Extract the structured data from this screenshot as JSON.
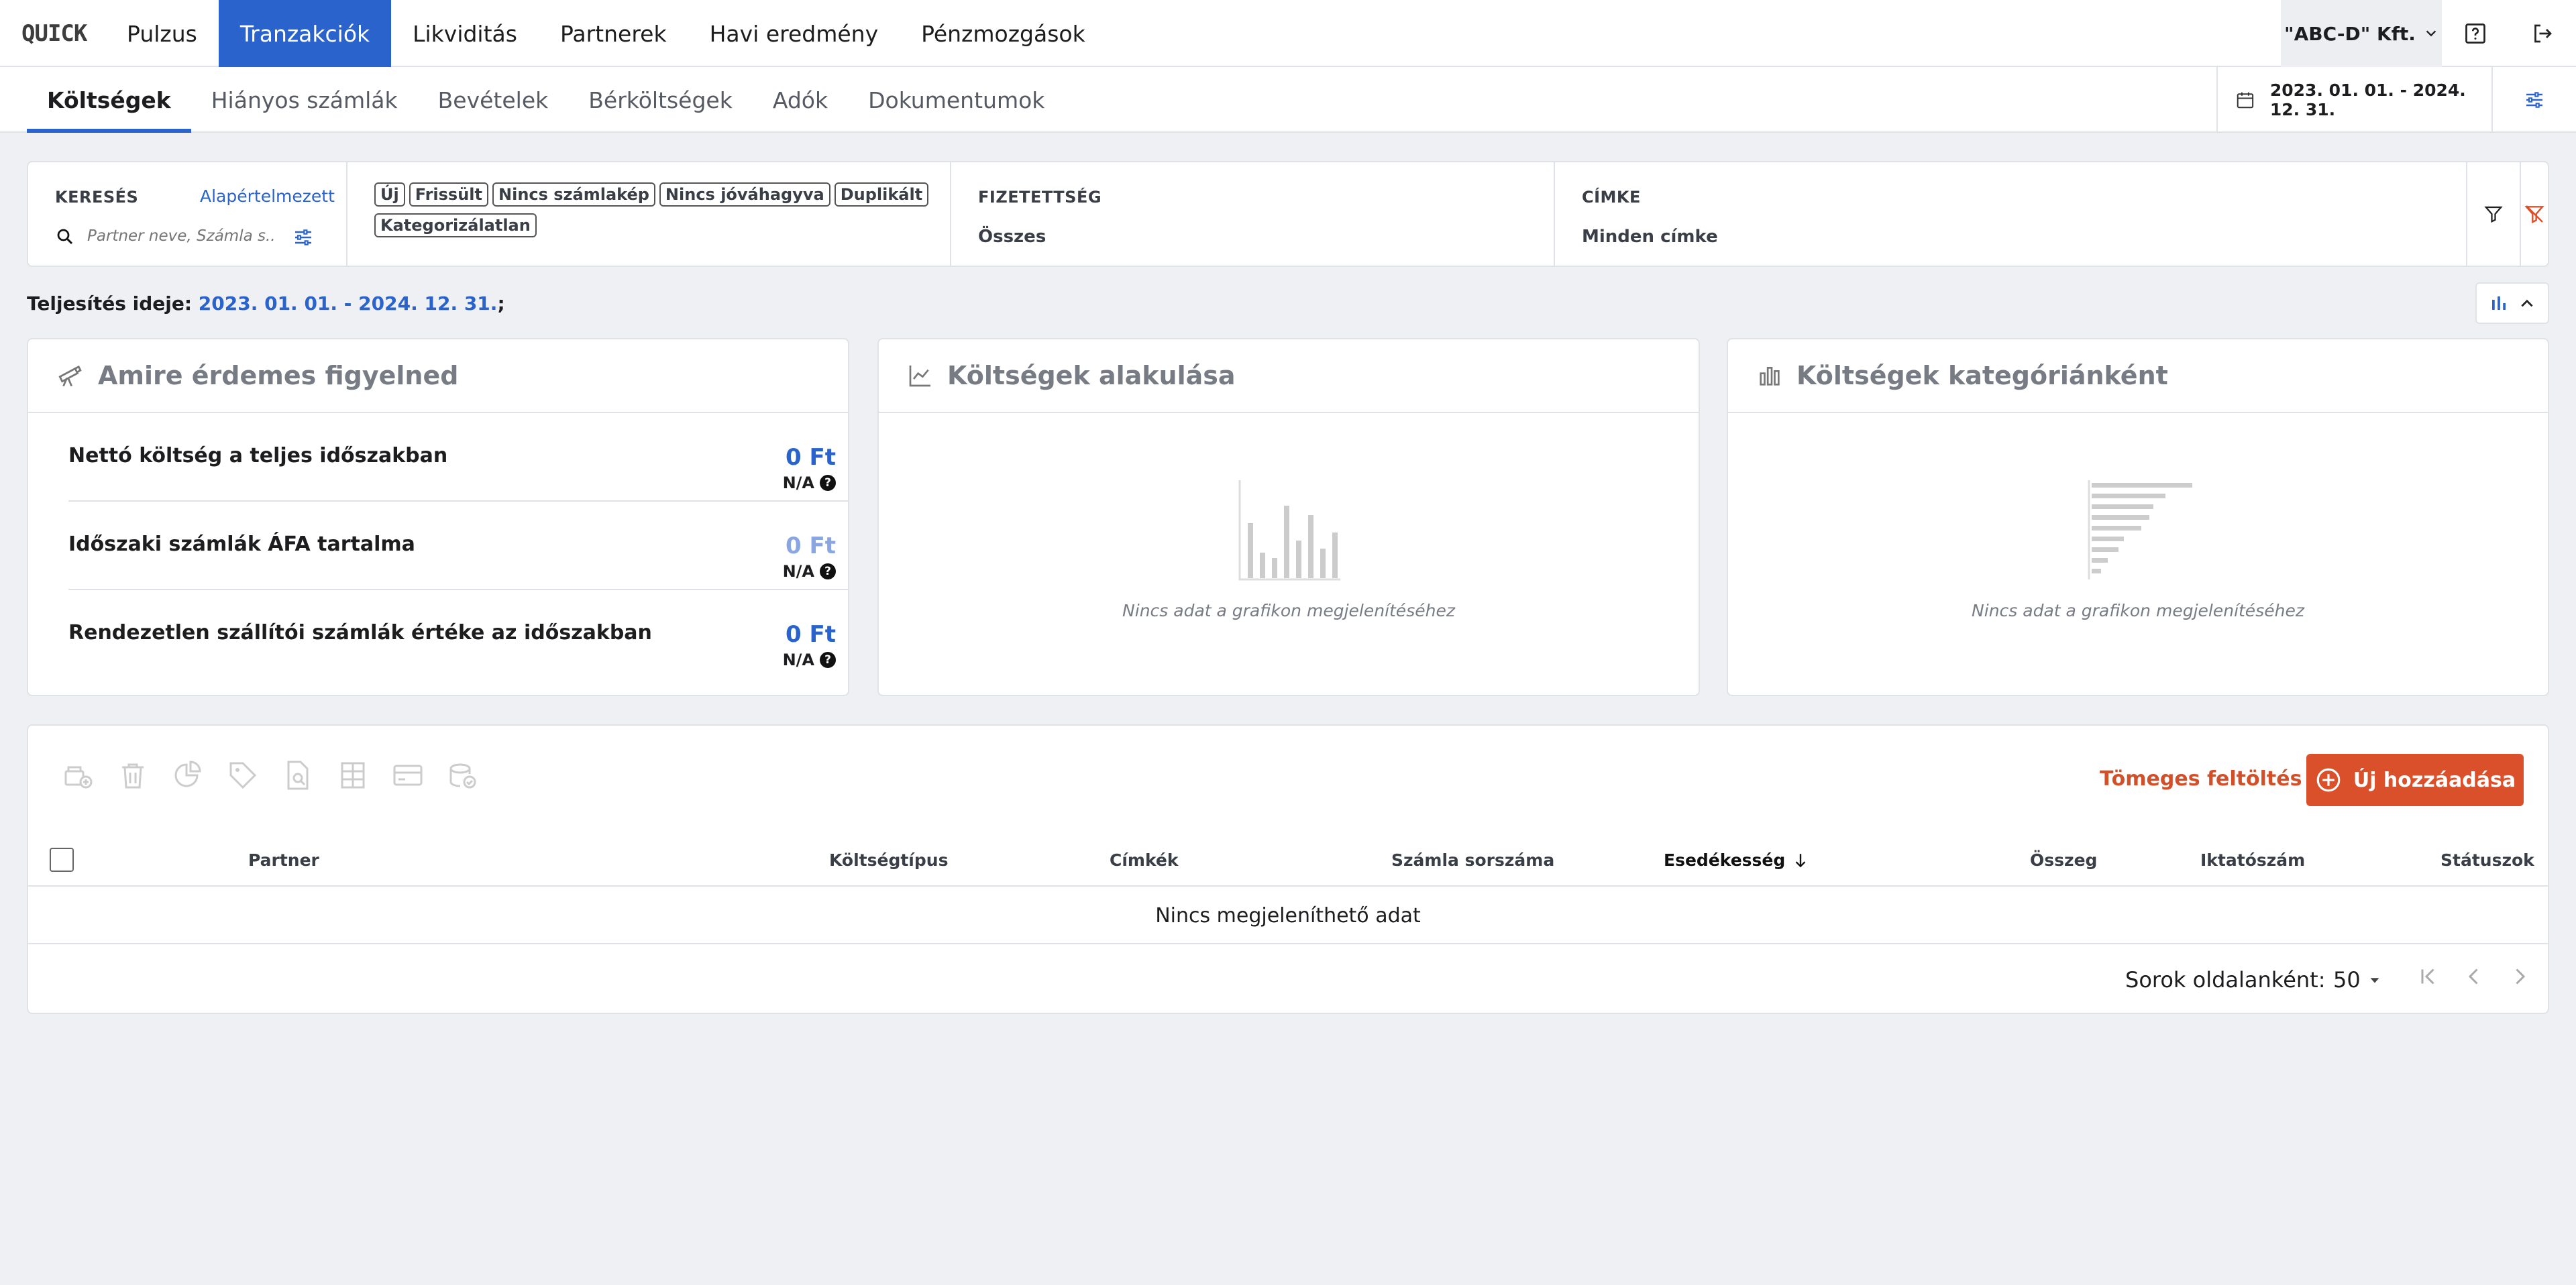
{
  "app": {
    "logo": "QUICK"
  },
  "main_nav": [
    {
      "label": "Pulzus",
      "active": false
    },
    {
      "label": "Tranzakciók",
      "active": true
    },
    {
      "label": "Likviditás",
      "active": false
    },
    {
      "label": "Partnerek",
      "active": false
    },
    {
      "label": "Havi eredmény",
      "active": false
    },
    {
      "label": "Pénzmozgások",
      "active": false
    }
  ],
  "company": {
    "name": "\"ABC-D\" Kft."
  },
  "sub_nav": [
    {
      "label": "Költségek",
      "active": true
    },
    {
      "label": "Hiányos számlák",
      "active": false
    },
    {
      "label": "Bevételek",
      "active": false
    },
    {
      "label": "Bérköltségek",
      "active": false
    },
    {
      "label": "Adók",
      "active": false
    },
    {
      "label": "Dokumentumok",
      "active": false
    }
  ],
  "date_range": "2023. 01. 01. - 2024. 12. 31.",
  "filters": {
    "search_label": "KERESÉS",
    "search_default_link": "Alapértelmezett",
    "search_placeholder": "Partner neve, Számla s...",
    "chips": [
      "Új",
      "Frissült",
      "Nincs számlakép",
      "Nincs jóváhagyva",
      "Duplikált",
      "Kategorizálatlan"
    ],
    "payment_label": "FIZETETTSÉG",
    "payment_value": "Összes",
    "tag_label": "CÍMKE",
    "tag_value": "Minden címke"
  },
  "performance": {
    "label": "Teljesítés ideje: ",
    "range": "2023. 01. 01. - 2024. 12. 31.",
    "suffix": ";"
  },
  "cards": {
    "watch": {
      "title": "Amire érdemes figyelned",
      "items": [
        {
          "label": "Nettó költség a teljes időszakban",
          "value": "0 Ft",
          "note": "N/A"
        },
        {
          "label": "Időszaki számlák ÁFA tartalma",
          "value": "0 Ft",
          "note": "N/A"
        },
        {
          "label": "Rendezetlen szállítói számlák értéke az időszakban",
          "value": "0 Ft",
          "note": "N/A"
        }
      ]
    },
    "trend": {
      "title": "Költségek alakulása",
      "empty": "Nincs adat a grafikon megjelenítéséhez"
    },
    "category": {
      "title": "Költségek kategóriánként",
      "empty": "Nincs adat a grafikon megjelenítéséhez"
    }
  },
  "table": {
    "bulk_upload": "Tömeges feltöltés",
    "add_new": "Új hozzáadása",
    "columns": [
      "Partner",
      "Költségtípus",
      "Címkék",
      "Számla sorszáma",
      "Esedékesség",
      "Összeg",
      "Iktatószám",
      "Státuszok"
    ],
    "sorted_column": "Esedékesség",
    "no_data": "Nincs megjeleníthető adat",
    "rows_per_page_label": "Sorok oldalanként:",
    "rows_per_page": "50"
  },
  "colors": {
    "accent": "#2a63cc",
    "action": "#d9502a",
    "background": "#eef0f3"
  }
}
